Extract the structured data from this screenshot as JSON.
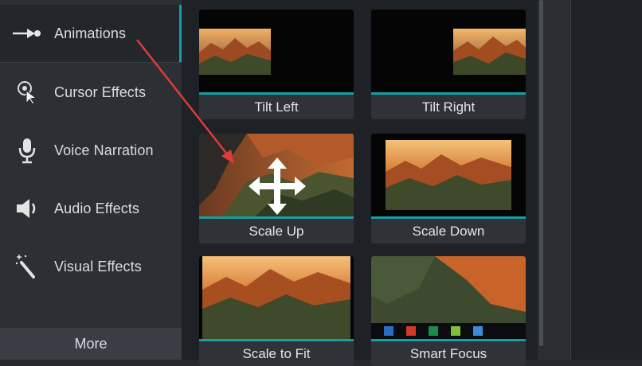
{
  "sidebar": {
    "items": [
      {
        "label": "Animations",
        "icon": "animation-arrow-icon",
        "active": true
      },
      {
        "label": "Cursor Effects",
        "icon": "cursor-effects-icon",
        "active": false
      },
      {
        "label": "Voice Narration",
        "icon": "microphone-icon",
        "active": false
      },
      {
        "label": "Audio Effects",
        "icon": "speaker-icon",
        "active": false
      },
      {
        "label": "Visual Effects",
        "icon": "magic-wand-icon",
        "active": false
      }
    ],
    "more_label": "More"
  },
  "gallery": {
    "tiles": [
      {
        "label": "Tilt Left"
      },
      {
        "label": "Tilt Right"
      },
      {
        "label": "Scale Up"
      },
      {
        "label": "Scale Down"
      },
      {
        "label": "Scale to Fit"
      },
      {
        "label": "Smart Focus"
      }
    ]
  },
  "colors": {
    "accent": "#169ea3",
    "annotation_arrow": "#e03a3a"
  }
}
